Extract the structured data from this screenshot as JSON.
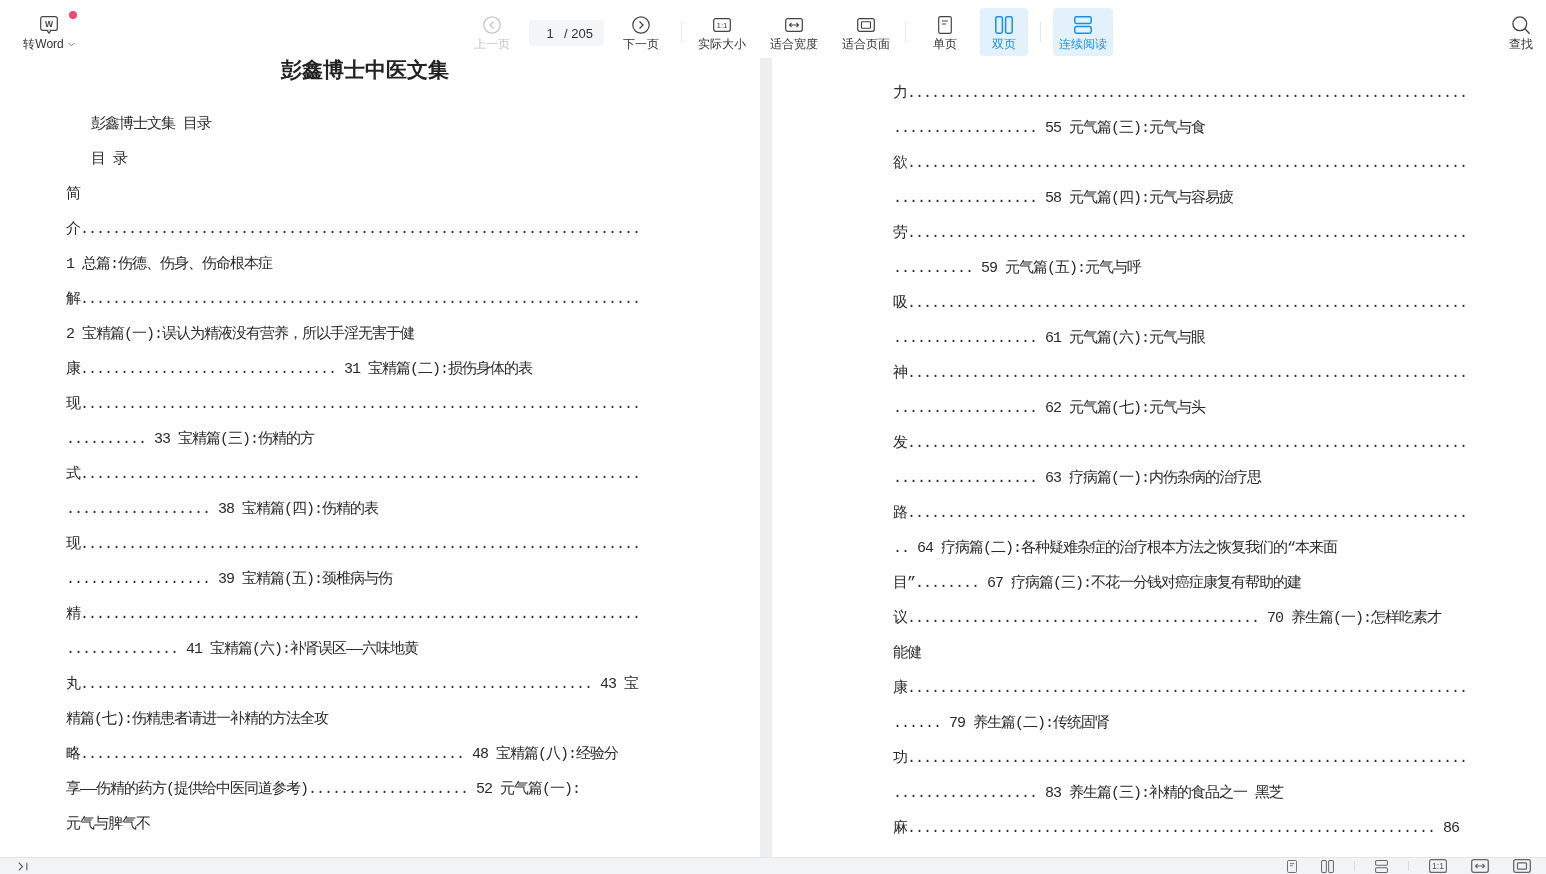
{
  "toolbar": {
    "convert_button": {
      "label": "转Word",
      "icon_letter": "W",
      "has_notification": true
    },
    "prev_button": {
      "label": "上一页",
      "disabled": true
    },
    "page_field": {
      "value": "1",
      "total": "/ 205"
    },
    "next_button": {
      "label": "下一页",
      "disabled": false
    },
    "zoom_buttons": [
      {
        "kind": "actual",
        "label": "实际大小",
        "icon_text": "1:1"
      },
      {
        "kind": "fit_width",
        "label": "适合宽度"
      },
      {
        "kind": "fit_page",
        "label": "适合页面"
      }
    ],
    "view_modes": [
      {
        "kind": "single",
        "label": "单页",
        "selected": false
      },
      {
        "kind": "double",
        "label": "双页",
        "selected": true
      }
    ],
    "continuous_button": {
      "label": "连续阅读",
      "selected": true
    },
    "search_button": {
      "label": "查找"
    }
  },
  "pages": [
    {
      "title": "彭鑫博士中医文集",
      "headings": [
        "彭鑫博士文集 目录",
        "目 录"
      ],
      "entries": [
        "简",
        "介......................................................................",
        "1 总篇:伤德、伤身、伤命根本症",
        "解......................................................................",
        "2 宝精篇(一):误认为精液没有营养，所以手淫无害于健",
        "康................................ 31 宝精篇(二):损伤身体的表",
        "现......................................................................",
        ".......... 33 宝精篇(三):伤精的方",
        "式......................................................................",
        ".................. 38 宝精篇(四):伤精的表",
        "现......................................................................",
        ".................. 39 宝精篇(五):颈椎病与伤",
        "精......................................................................",
        ".............. 41 宝精篇(六):补肾误区——六味地黄",
        "丸................................................................ 43 宝",
        "精篇(七):伤精患者请进一补精的方法全攻",
        "略................................................ 48 宝精篇(八):经验分",
        "享——伤精的药方(提供给中医同道参考).................... 52 元气篇(一):",
        "元气与脾气不"
      ]
    },
    {
      "entries": [
        "力......................................................................",
        ".................. 55 元气篇(三):元气与食",
        "欲......................................................................",
        ".................. 58 元气篇(四):元气与容易疲",
        "劳......................................................................",
        ".......... 59 元气篇(五):元气与呼",
        "吸......................................................................",
        ".................. 61 元气篇(六):元气与眼",
        "神......................................................................",
        ".................. 62 元气篇(七):元气与头",
        "发......................................................................",
        ".................. 63 疗病篇(一):内伤杂病的治疗思",
        "路......................................................................",
        ".. 64 疗病篇(二):各种疑难杂症的治疗根本方法之恢复我们的“本来面",
        "目”........ 67 疗病篇(三):不花一分钱对癌症康复有帮助的建",
        "议............................................ 70 养生篇(一):怎样吃素才",
        "能健",
        "康......................................................................",
        "...... 79 养生篇(二):传统固肾",
        "功......................................................................",
        ".................. 83 养生篇(三):补精的食品之一 黑芝",
        "麻.................................................................. 86"
      ]
    }
  ],
  "bottom_bar": {
    "tools": [
      {
        "kind": "single"
      },
      {
        "kind": "double"
      },
      {
        "kind": "continuous"
      },
      {
        "kind": "actual",
        "icon_text": "1:1"
      },
      {
        "kind": "fit_width"
      },
      {
        "kind": "fit_page"
      }
    ]
  }
}
